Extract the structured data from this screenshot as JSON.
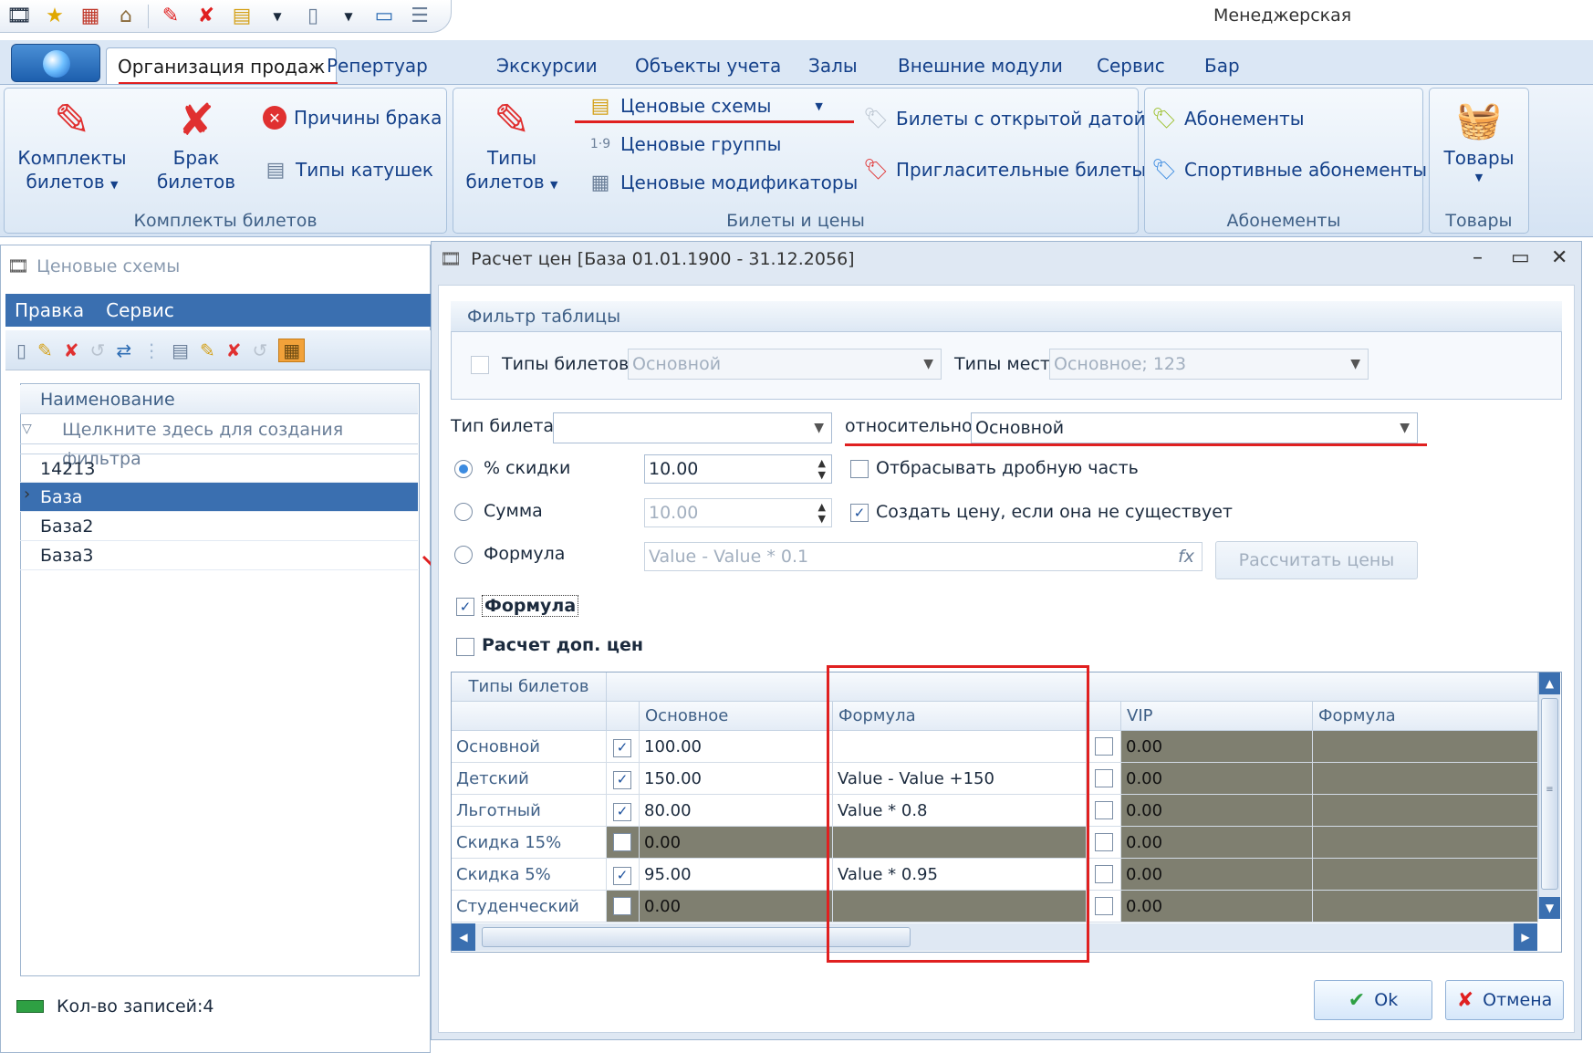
{
  "app": {
    "title": "Менеджерская"
  },
  "qat": {
    "icons": [
      "app-logo-icon",
      "star-icon",
      "calendar-icon",
      "store-icon",
      "ticket-icon",
      "ticket-cancel-icon",
      "report-icon",
      "dropdown-icon",
      "document-icon",
      "dropdown-icon",
      "monitor-icon",
      "list-icon"
    ]
  },
  "tabs": [
    "Организация продаж",
    "Репертуар",
    "Экскурсии",
    "Объекты учета",
    "Залы",
    "Внешние модули",
    "Сервис",
    "Бар"
  ],
  "ribbon": {
    "g1": {
      "caption": "Комплекты билетов",
      "kits_l1": "Комплекты",
      "kits_l2": "билетов",
      "defect_l1": "Брак",
      "defect_l2": "билетов",
      "reasons": "Причины брака",
      "reels": "Типы катушек"
    },
    "g2": {
      "caption": "Билеты и цены",
      "types_l1": "Типы",
      "types_l2": "билетов",
      "schemes": "Ценовые схемы",
      "groups": "Ценовые группы",
      "modifiers": "Ценовые модификаторы",
      "open_date": "Билеты с открытой датой",
      "invite": "Пригласительные билеты"
    },
    "g3": {
      "caption": "Абонементы",
      "subs": "Абонементы",
      "sport": "Спортивные абонементы"
    },
    "g4": {
      "caption": "Товары",
      "goods": "Товары"
    }
  },
  "left": {
    "title": "Ценовые схемы",
    "menu": [
      "Правка",
      "Сервис"
    ],
    "grid_header": "Наименование",
    "filter_hint": "Щелкните здесь для создания фильтра",
    "rows": [
      "14213",
      "База",
      "База2",
      "База3"
    ],
    "status": "Кол-во записей:4"
  },
  "dialog": {
    "title": "Расчет цен [База 01.01.1900 - 31.12.2056]",
    "filter_title": "Фильтр таблицы",
    "ticket_types_label": "Типы билетов",
    "ticket_types_value": "Основной",
    "seat_types_label": "Типы мест",
    "seat_types_value": "Основное; 123",
    "ticket_type_label": "Тип билета",
    "ticket_type_value": "",
    "relative_label": "относительно",
    "relative_value": "Основной",
    "discount_label": "% скидки",
    "discount_value": "10.00",
    "sum_label": "Сумма",
    "sum_value": "10.00",
    "formula_radio_label": "Формула",
    "formula_value": "Value - Value * 0.1",
    "drop_fraction": "Отбрасывать дробную часть",
    "create_price": "Создать цену, если она не существует",
    "calc_btn": "Рассчитать цены",
    "formula_cb": "Формула",
    "extra_cb": "Расчет доп. цен",
    "ok": "Ok",
    "cancel": "Отмена"
  },
  "price_grid": {
    "corner": "Типы билетов",
    "columns": [
      "Основное",
      "Формула",
      "VIP",
      "Формула"
    ],
    "rows": [
      {
        "name": "Основной",
        "c1": true,
        "v1": "100.00",
        "f1": "",
        "c2": false,
        "v2": "0.00",
        "f2": ""
      },
      {
        "name": "Детский",
        "c1": true,
        "v1": "150.00",
        "f1": "Value - Value +150",
        "c2": false,
        "v2": "0.00",
        "f2": ""
      },
      {
        "name": "Льготный",
        "c1": true,
        "v1": "80.00",
        "f1": "Value * 0.8",
        "c2": false,
        "v2": "0.00",
        "f2": ""
      },
      {
        "name": "Скидка 15%",
        "c1": false,
        "v1": "0.00",
        "f1": "",
        "c2": false,
        "v2": "0.00",
        "f2": ""
      },
      {
        "name": "Скидка 5%",
        "c1": true,
        "v1": "95.00",
        "f1": "Value * 0.95",
        "c2": false,
        "v2": "0.00",
        "f2": ""
      },
      {
        "name": "Студенческий",
        "c1": false,
        "v1": "0.00",
        "f1": "",
        "c2": false,
        "v2": "0.00",
        "f2": ""
      }
    ]
  },
  "colors": {
    "accent": "#3a6fb0",
    "annotation": "#e02020",
    "disabled_cell": "#7f7f70"
  }
}
